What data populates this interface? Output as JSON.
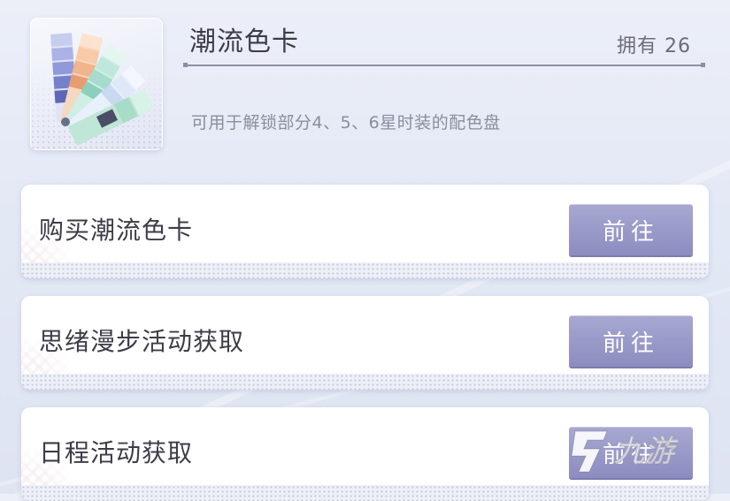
{
  "item": {
    "title": "潮流色卡",
    "owned": "拥有 26",
    "description": "可用于解锁部分4、5、6星时装的配色盘",
    "icon": "color-swatch-fan-icon"
  },
  "sources": [
    {
      "label": "购买潮流色卡",
      "button": "前往"
    },
    {
      "label": "思绪漫步活动获取",
      "button": "前往"
    },
    {
      "label": "日程活动获取",
      "button": "前往"
    }
  ],
  "watermark": {
    "text": "九游",
    "mark": "9"
  },
  "colors": {
    "button": "#9a9ac9",
    "title_text": "#3d3d48",
    "desc_text": "#8b8d9c"
  }
}
